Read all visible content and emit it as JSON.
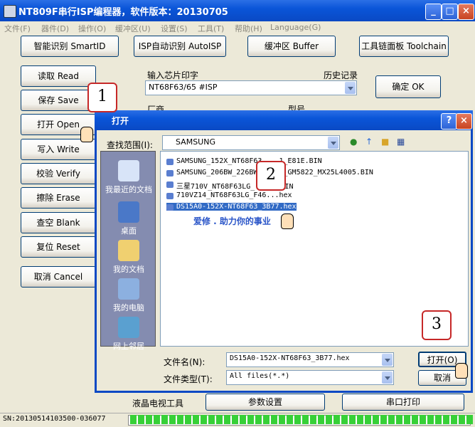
{
  "window": {
    "title": "NT809F串行ISP编程器，软件版本：20130705"
  },
  "menu": [
    "文件(F)",
    "器件(D)",
    "操作(O)",
    "缓冲区(U)",
    "设置(S)",
    "工具(T)",
    "帮助(H)",
    "Language(G)"
  ],
  "toolbar": {
    "smart": "智能识别 SmartID",
    "autoisp": "ISP自动识别 AutoISP",
    "buffer": "缓冲区 Buffer",
    "toolchain": "工具链面板 Toolchain"
  },
  "side": {
    "read": "读取 Read",
    "save": "保存 Save",
    "open": "打开 Open",
    "write": "写入 Write",
    "verify": "校验 Verify",
    "erase": "擦除 Erase",
    "blank": "查空 Blank",
    "reset": "复位 Reset",
    "cancel": "取消 Cancel"
  },
  "chip": {
    "label": "输入芯片印字",
    "history": "历史记录",
    "value": "NT68F63/65 #ISP",
    "ok": "确定 OK",
    "vendor": "厂商",
    "model": "型号"
  },
  "dialog": {
    "title": "打开",
    "lookin_label": "查找范围(I):",
    "lookin_value": "SAMSUNG",
    "places": [
      "我最近的文档",
      "桌面",
      "我的文档",
      "我的电脑",
      "网上邻居"
    ],
    "files": [
      "SAMSUNG_152X_NT68F63_...1_E81E.BIN",
      "SAMSUNG_206BW_226BW...07A_GM5822_MX25L4005.BIN",
      "三星710V_NT68F63LG_...E9.BIN",
      "710VZ14_NT68F63LG_F46...hex",
      "DS15A0-152X-NT68F63_3B77.hex"
    ],
    "filename_label": "文件名(N):",
    "filename_value": "DS15A0-152X-NT68F63_3B77.hex",
    "filetype_label": "文件类型(T):",
    "filetype_value": "All files(*.*)",
    "open_btn": "打开(O)",
    "cancel_btn": "取消",
    "watermark": "爱修 . 助力你的事业"
  },
  "callouts": [
    "1",
    "2",
    "3"
  ],
  "bottom": {
    "lcd": "液晶电视工具",
    "params": "参数设置",
    "serial": "串口打印"
  },
  "status": {
    "sn": "SN:20130514103500-036077"
  }
}
